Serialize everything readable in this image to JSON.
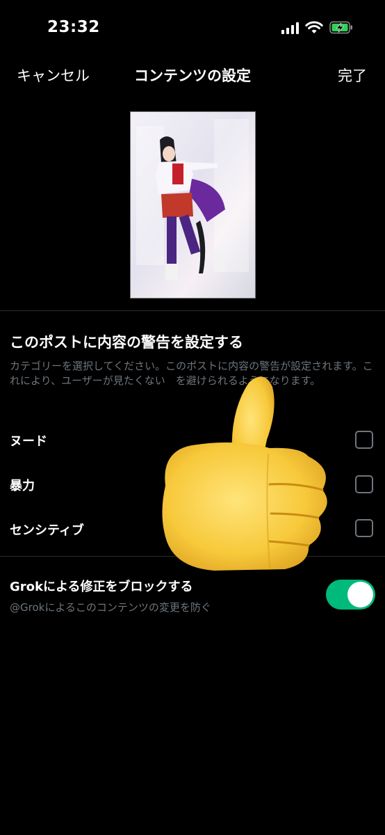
{
  "status_bar": {
    "time": "23:32",
    "signal_icon": "signal-icon",
    "wifi_icon": "wifi-icon",
    "battery_icon": "battery-charging-icon",
    "battery_color": "#30d158"
  },
  "nav": {
    "cancel_label": "キャンセル",
    "title": "コンテンツの設定",
    "done_label": "完了"
  },
  "media": {
    "description_icon": "photo-thumbnail"
  },
  "content_warning": {
    "title": "このポストに内容の警告を設定する",
    "description": "カテゴリーを選択してください。このポストに内容の警告が設定されます。これにより、ユーザーが見たくない　を避けられるようになります。",
    "options": [
      {
        "label": "ヌード",
        "checked": false
      },
      {
        "label": "暴力",
        "checked": false
      },
      {
        "label": "センシティブ",
        "checked": false
      }
    ]
  },
  "grok": {
    "title": "Grokによる修正をブロックする",
    "description": "@Grokによるこのコンテンツの変更を防ぐ",
    "toggle_on": true,
    "toggle_color": "#00ba7c"
  },
  "overlay": {
    "icon": "thumbs-up-emoji-icon"
  }
}
